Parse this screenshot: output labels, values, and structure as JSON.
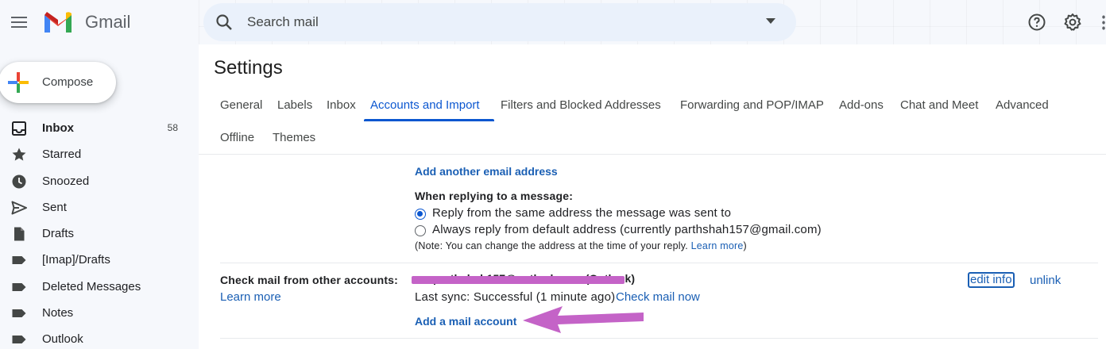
{
  "header": {
    "brand": "Gmail",
    "search_placeholder": "Search mail"
  },
  "compose": {
    "label": "Compose"
  },
  "sidebar": {
    "items": [
      {
        "label": "Inbox",
        "count": "58",
        "icon": "inbox-icon",
        "active": true
      },
      {
        "label": "Starred",
        "count": "",
        "icon": "star-icon"
      },
      {
        "label": "Snoozed",
        "count": "",
        "icon": "clock-icon"
      },
      {
        "label": "Sent",
        "count": "",
        "icon": "send-icon"
      },
      {
        "label": "Drafts",
        "count": "",
        "icon": "draft-icon"
      },
      {
        "label": "[Imap]/Drafts",
        "count": "",
        "icon": "label-icon"
      },
      {
        "label": "Deleted Messages",
        "count": "",
        "icon": "label-icon"
      },
      {
        "label": "Notes",
        "count": "",
        "icon": "label-icon"
      },
      {
        "label": "Outlook",
        "count": "",
        "icon": "label-icon"
      }
    ]
  },
  "settings": {
    "title": "Settings",
    "tabs": [
      "General",
      "Labels",
      "Inbox",
      "Accounts and Import",
      "Filters and Blocked Addresses",
      "Forwarding and POP/IMAP",
      "Add-ons",
      "Chat and Meet",
      "Advanced",
      "Offline",
      "Themes"
    ],
    "active_tab": "Accounts and Import",
    "send_as": {
      "add_email_link": "Add another email address",
      "reply_heading": "When replying to a message:",
      "reply_option_1": "Reply from the same address the message was sent to",
      "reply_option_2": "Always reply from default address (currently parthshah157@gmail.com)",
      "note": "(Note: You can change the address at the time of your reply.",
      "note_link": "Learn more",
      "note_close": ")"
    },
    "check_mail": {
      "label": "Check mail from other accounts:",
      "learn_more": "Learn more",
      "account": "parthshah157@outlook.com (Outlook)",
      "last_sync": "Last sync: Successful (1 minute ago)",
      "check_now": "Check mail now",
      "edit_info": "edit info",
      "unlink": "unlink",
      "add_account": "Add a mail account"
    }
  },
  "colors": {
    "accent": "#0b57d0",
    "link": "#1a5fb4",
    "annotation": "#c463c7"
  }
}
